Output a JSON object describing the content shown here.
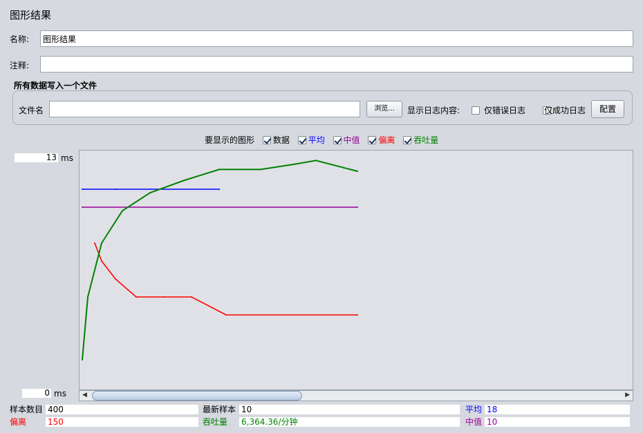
{
  "window": {
    "title": "图形结果"
  },
  "form": {
    "name_label": "名称:",
    "name_value": "图形结果",
    "comment_label": "注释:",
    "comment_value": ""
  },
  "file_section": {
    "title": "所有数据写入一个文件",
    "filename_label": "文件名",
    "filename_value": "",
    "browse_label": "浏览...",
    "log_content_label": "显示日志内容:",
    "errors_only_label": "仅错误日志",
    "errors_only_checked": false,
    "success_only_label": "仅成功日志",
    "success_only_checked": false,
    "configure_label": "配置"
  },
  "legend": {
    "heading": "要显示的图形",
    "items": [
      {
        "label": "数据",
        "checked": true,
        "color": "#000000"
      },
      {
        "label": "平均",
        "checked": true,
        "color": "#0000ff"
      },
      {
        "label": "中值",
        "checked": true,
        "color": "#990099"
      },
      {
        "label": "偏离",
        "checked": true,
        "color": "#ff0000"
      },
      {
        "label": "吞吐量",
        "checked": true,
        "color": "#008000"
      }
    ]
  },
  "axis": {
    "y_max_value": "13",
    "y_min_value": "0",
    "y_unit": "ms"
  },
  "chart_data": {
    "type": "line",
    "ylim": [
      0,
      13
    ],
    "x_range": [
      0,
      400
    ],
    "series": [
      {
        "name": "平均",
        "color": "#0000ff",
        "values": [
          [
            2,
            11
          ],
          [
            50,
            11
          ],
          [
            200,
            11
          ]
        ]
      },
      {
        "name": "中值",
        "color": "#990099",
        "values": [
          [
            2,
            10
          ],
          [
            400,
            10
          ]
        ]
      },
      {
        "name": "偏离",
        "color": "#ff0000",
        "values": [
          [
            20,
            8
          ],
          [
            30,
            7
          ],
          [
            50,
            6
          ],
          [
            80,
            5
          ],
          [
            120,
            5
          ],
          [
            160,
            5
          ],
          [
            210,
            4
          ],
          [
            400,
            4
          ]
        ]
      },
      {
        "name": "吞吐量",
        "color": "#008000",
        "values": [
          [
            2,
            1.5
          ],
          [
            10,
            5
          ],
          [
            30,
            8
          ],
          [
            60,
            9.8
          ],
          [
            100,
            10.8
          ],
          [
            150,
            11.5
          ],
          [
            200,
            12.1
          ],
          [
            260,
            12.1
          ],
          [
            310,
            12.4
          ],
          [
            340,
            12.6
          ],
          [
            380,
            12.2
          ],
          [
            400,
            12
          ]
        ]
      }
    ]
  },
  "stats": {
    "samples_label": "样本数目",
    "samples_value": "400",
    "latest_label": "最新样本",
    "latest_value": "10",
    "average_label": "平均",
    "average_value": "18",
    "deviation_label": "偏离",
    "deviation_value": "150",
    "throughput_label": "吞吐量",
    "throughput_value": "6,364.36/分钟",
    "median_label": "中值",
    "median_value": "10"
  },
  "colors": {
    "background": "#d6d9df",
    "data": "#000000",
    "average": "#0000ff",
    "median": "#990099",
    "deviation": "#ff0000",
    "throughput": "#008000"
  }
}
